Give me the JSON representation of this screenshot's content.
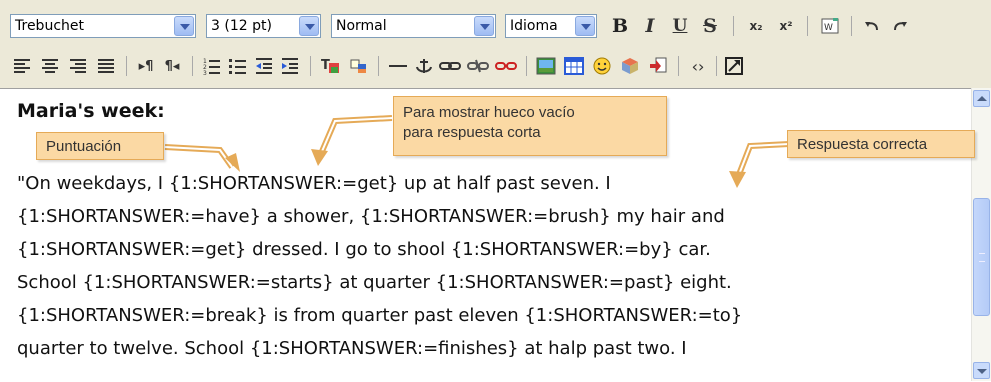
{
  "toolbar": {
    "font_family": "Trebuchet",
    "font_size": "3 (12 pt)",
    "format": "Normal",
    "language": "Idioma",
    "bold": "B",
    "italic": "I",
    "underline": "U",
    "strike": "S",
    "subscript": "x₂",
    "superscript": "x²"
  },
  "editor": {
    "heading": "Maria's week:",
    "lines": [
      "\"On weekdays, I {1:SHORTANSWER:=get} up at half past seven. I",
      "{1:SHORTANSWER:=have} a shower, {1:SHORTANSWER:=brush} my hair and",
      "{1:SHORTANSWER:=get} dressed. I go to shool {1:SHORTANSWER:=by} car.",
      "School {1:SHORTANSWER:=starts} at quarter {1:SHORTANSWER:=past} eight.",
      "{1:SHORTANSWER:=break} is from quarter past eleven {1:SHORTANSWER:=to}",
      "quarter to twelve. School {1:SHORTANSWER:=finishes} at halp past two. I"
    ]
  },
  "callouts": {
    "score": "Puntuación",
    "blank": "Para mostrar hueco vacío\npara respuesta corta",
    "blank_line1": "Para mostrar hueco vacío",
    "blank_line2": "para respuesta corta",
    "correct": "Respuesta correcta"
  },
  "colors": {
    "toolbar_bg": "#ece9d8",
    "callout_bg": "#fbd9a4",
    "callout_border": "#e5aa57"
  }
}
